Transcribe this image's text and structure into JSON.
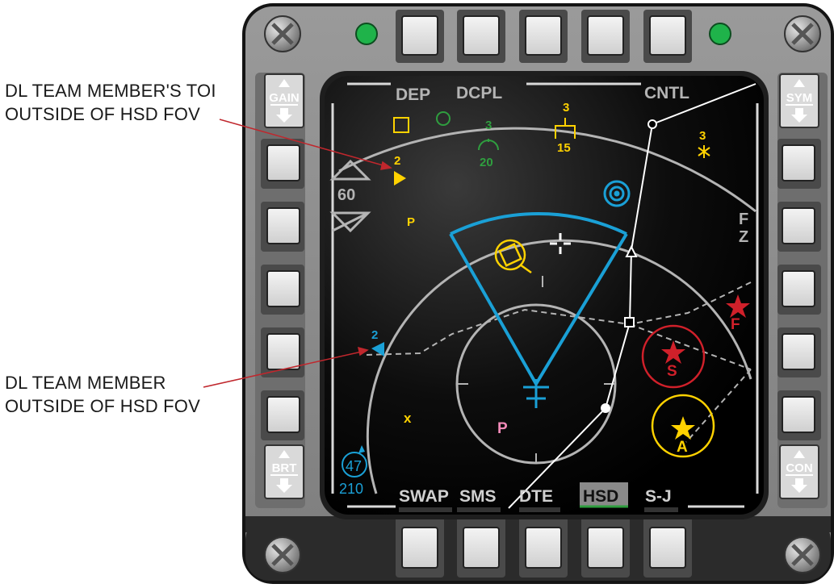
{
  "annotations": {
    "toi": {
      "line1": "DL TEAM MEMBER'S TOI",
      "line2": "OUTSIDE OF HSD FOV"
    },
    "member": {
      "line1": "DL TEAM MEMBER",
      "line2": "OUTSIDE OF HSD FOV"
    }
  },
  "bezel": {
    "left_rocker_top": "GAIN",
    "left_rocker_bottom": "BRT",
    "right_rocker_top": "SYM",
    "right_rocker_bottom": "CON",
    "status_lights": [
      "green",
      "green"
    ]
  },
  "display": {
    "top_labels": {
      "dep": "DEP",
      "dcpl": "DCPL",
      "cntl": "CNTL"
    },
    "bottom_labels": {
      "swap": "SWAP",
      "sms": "SMS",
      "dte": "DTE",
      "hsd": "HSD",
      "s_j": "S-J"
    },
    "range_scale": "60",
    "fz_f": "F",
    "fz_z": "Z",
    "toi_marker_number": "2",
    "member_marker_number": "2",
    "yellow_top_number": "3",
    "yellow_top_value": "15",
    "green_top_number": "3",
    "green_value": "20",
    "star_number": "3",
    "p_yellow": "P",
    "p_pink": "P",
    "x_mark": "x",
    "threat_f": "F",
    "threat_s": "S",
    "threat_a": "A",
    "ownship_heading": "47",
    "ownship_altitude": "210"
  },
  "colors": {
    "bezel": "#8c8c8c",
    "screen": "#000000",
    "cyan": "#1aa0d6",
    "yellow": "#ffd200",
    "green": "#2f9e3f",
    "red": "#d0202a",
    "pink": "#f28ab8",
    "grey": "#b4b4b4",
    "leader": "#c0272d"
  }
}
